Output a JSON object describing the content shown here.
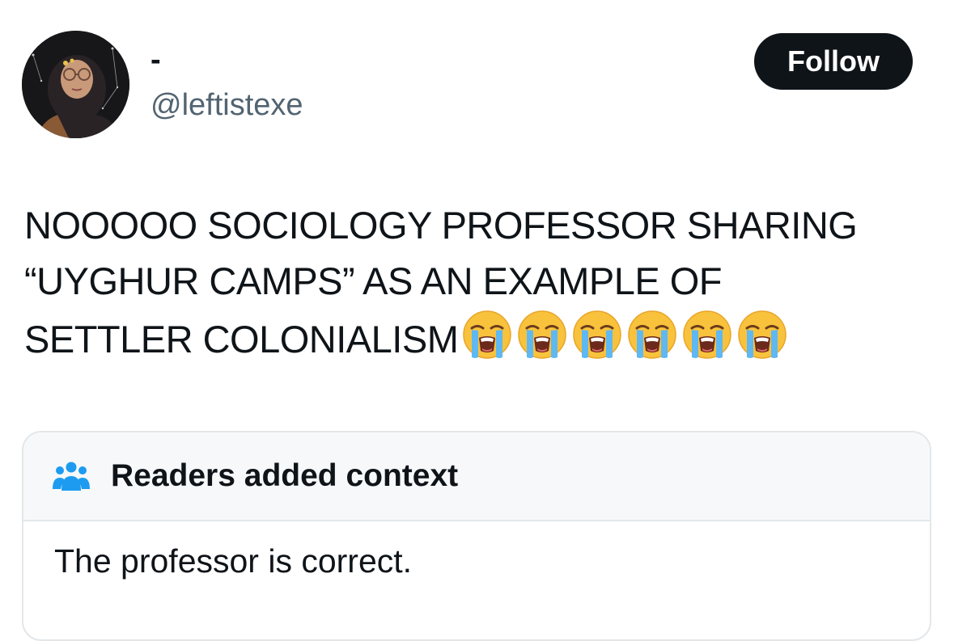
{
  "user": {
    "display_name": "-",
    "handle": "@leftistexe"
  },
  "follow_button": {
    "label": "Follow"
  },
  "tweet": {
    "lines": [
      "NOOOOO SOCIOLOGY PROFESSOR SHARING",
      "“UYGHUR CAMPS” AS AN EXAMPLE OF",
      "SETTLER COLONIALISM"
    ],
    "emojis": [
      "😭",
      "😭",
      "😭",
      "😭",
      "😭",
      "😭"
    ]
  },
  "community_note": {
    "title": "Readers added context",
    "icon": "people-icon",
    "body": "The professor is correct."
  },
  "colors": {
    "text_primary": "#0f1419",
    "text_secondary": "#536471",
    "accent_blue": "#1d9bf0",
    "card_header_bg": "#f7f8f9",
    "card_border": "#e3e7ea"
  }
}
